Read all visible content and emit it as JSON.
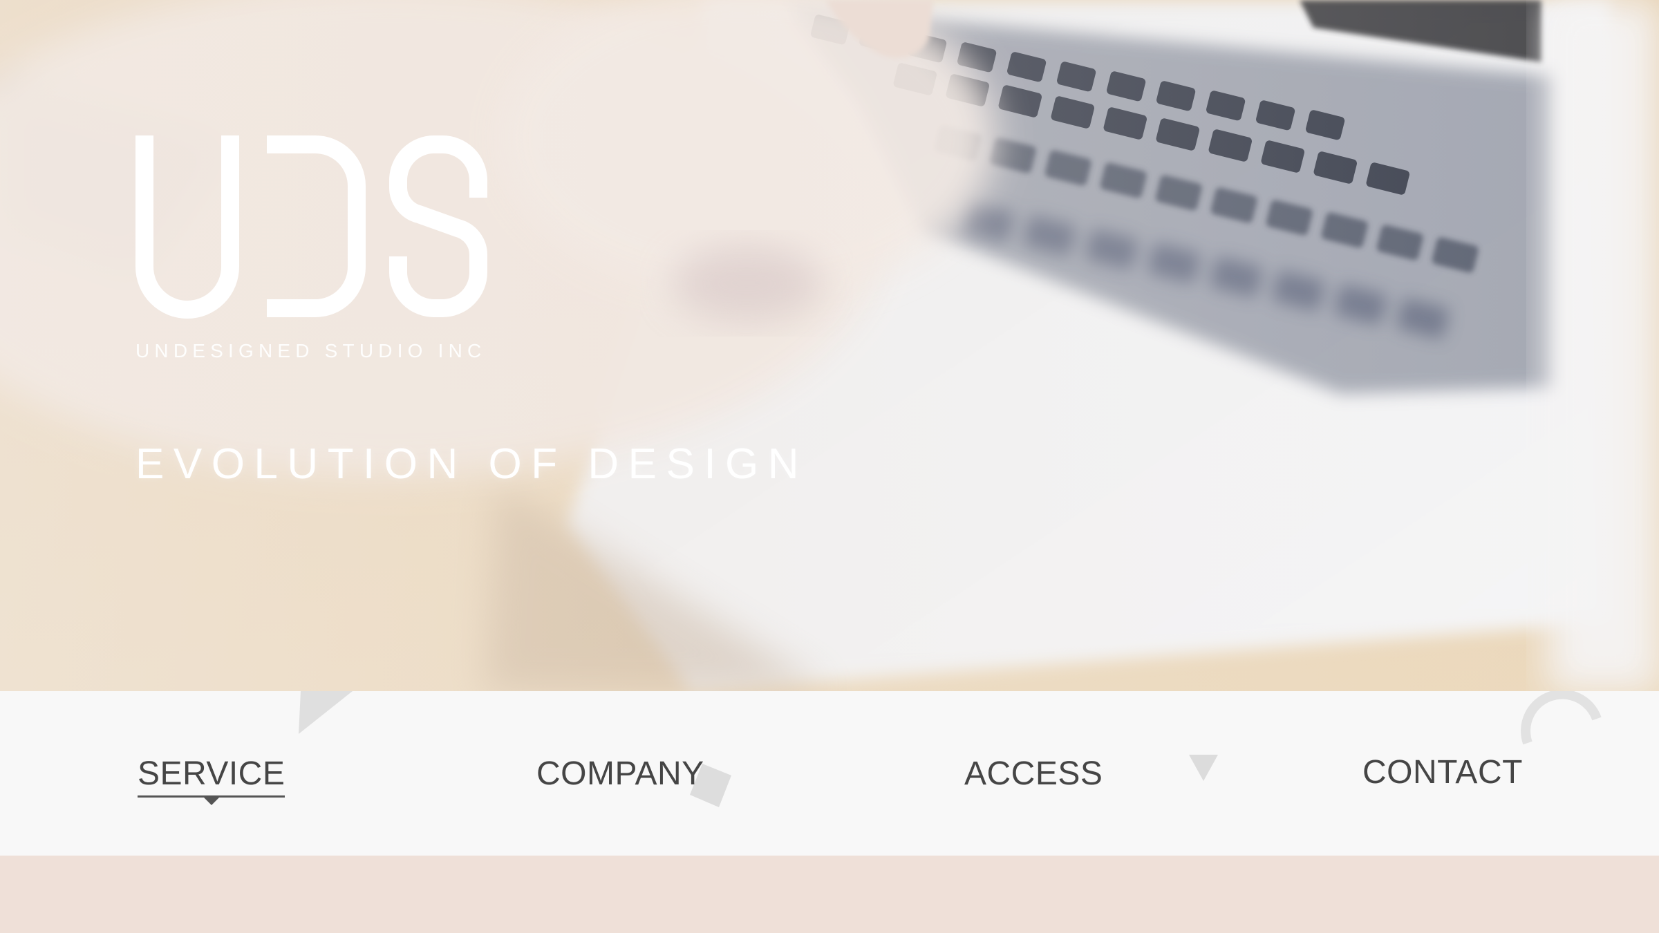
{
  "hero": {
    "logo_text": "UDS",
    "company_name": "UNDESIGNED STUDIO INC",
    "tagline": "EVOLUTION OF DESIGN",
    "background_image": "laptop-keyboard-typing-photo"
  },
  "nav": {
    "items": [
      {
        "label": "SERVICE",
        "active": true
      },
      {
        "label": "COMPANY",
        "active": false
      },
      {
        "label": "ACCESS",
        "active": false
      },
      {
        "label": "CONTACT",
        "active": false
      }
    ]
  },
  "colors": {
    "hero_overlay": "#efe9e2",
    "nav_background": "#f8f8f8",
    "nav_text": "#454545",
    "band": "#efe0d8",
    "logo": "#ffffff"
  }
}
